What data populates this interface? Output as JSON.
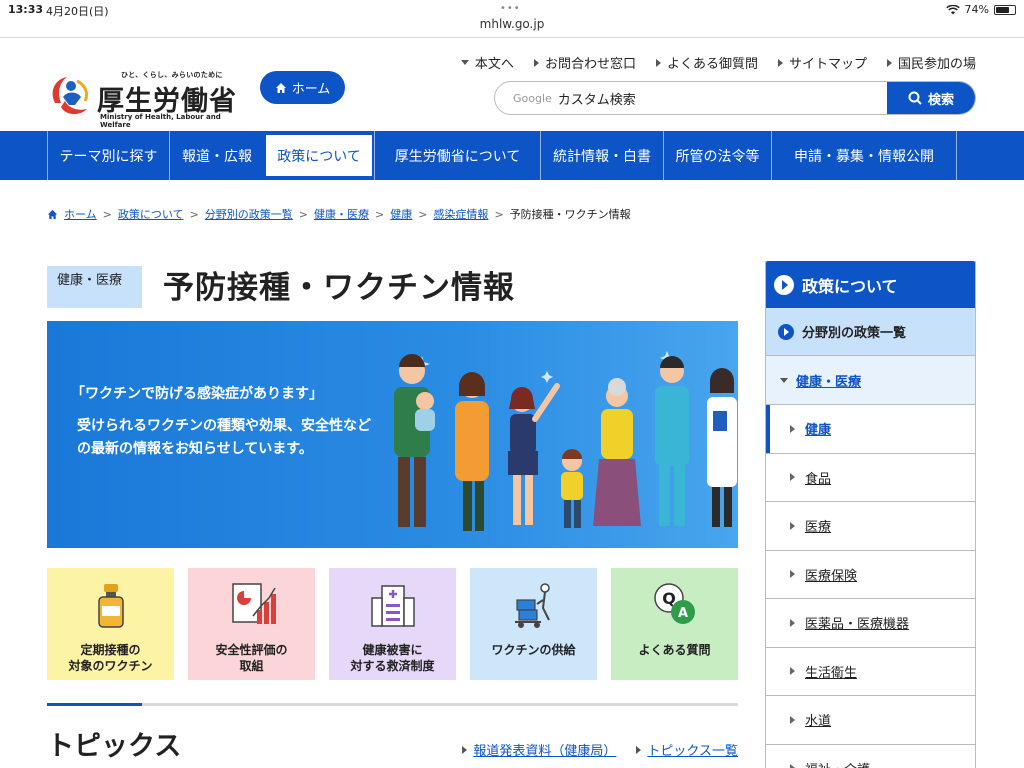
{
  "status_bar": {
    "time": "13:33",
    "date": "4月20日(日)",
    "url": "mhlw.go.jp",
    "battery": "74%",
    "battery_level": 0.74
  },
  "header": {
    "logo_tagline": "ひと、くらし、みらいのために",
    "logo_title": "厚生労働省",
    "logo_english": "Ministry of Health, Labour and Welfare",
    "home_button": "ホーム",
    "util_links": [
      "本文へ",
      "お問合わせ窓口",
      "よくある御質問",
      "サイトマップ",
      "国民参加の場"
    ],
    "search_brand": "Google",
    "search_placeholder": "カスタム検索",
    "search_button": "検索"
  },
  "global_nav": [
    {
      "label": "テーマ別に探す",
      "active": false
    },
    {
      "label": "報道・広報",
      "active": false
    },
    {
      "label": "政策について",
      "active": true
    },
    {
      "label": "厚生労働省について",
      "active": false
    },
    {
      "label": "統計情報・白書",
      "active": false
    },
    {
      "label": "所管の法令等",
      "active": false
    },
    {
      "label": "申請・募集・情報公開",
      "active": false
    }
  ],
  "breadcrumb": [
    "ホーム",
    "政策について",
    "分野別の政策一覧",
    "健康・医療",
    "健康",
    "感染症情報",
    "予防接種・ワクチン情報"
  ],
  "category_tag": "健康・医療",
  "page_title": "予防接種・ワクチン情報",
  "hero": {
    "quote": "「ワクチンで防げる感染症があります」",
    "body": "受けられるワクチンの種類や効果、安全性などの最新の情報をお知らせしています。"
  },
  "tiles": [
    {
      "line1": "定期接種の",
      "line2": "対象のワクチン",
      "color": "#fcf3a5",
      "icon": "vaccine-vial-icon"
    },
    {
      "line1": "安全性評価の",
      "line2": "取組",
      "color": "#fbd5d8",
      "icon": "evaluation-chart-icon"
    },
    {
      "line1": "健康被害に",
      "line2": "対する救済制度",
      "color": "#e6d8f8",
      "icon": "hospital-icon"
    },
    {
      "line1": "ワクチンの供給",
      "line2": "",
      "color": "#cde6fa",
      "icon": "delivery-cart-icon"
    },
    {
      "line1": "よくある質問",
      "line2": "",
      "color": "#c8edc3",
      "icon": "qa-bubble-icon"
    }
  ],
  "topics": {
    "title": "トピックス",
    "links": [
      "報道発表資料（健康局）",
      "トピックス一覧"
    ]
  },
  "side_nav": {
    "heading": "政策について",
    "sub": "分野別の政策一覧",
    "category": "健康・医療",
    "items": [
      "健康",
      "食品",
      "医療",
      "医療保険",
      "医薬品・医療機器",
      "生活衛生",
      "水道",
      "福祉・介護"
    ],
    "current_index": 0
  },
  "colors": {
    "brand_blue": "#0d55c6",
    "tag_blue": "#c8e1fb"
  }
}
